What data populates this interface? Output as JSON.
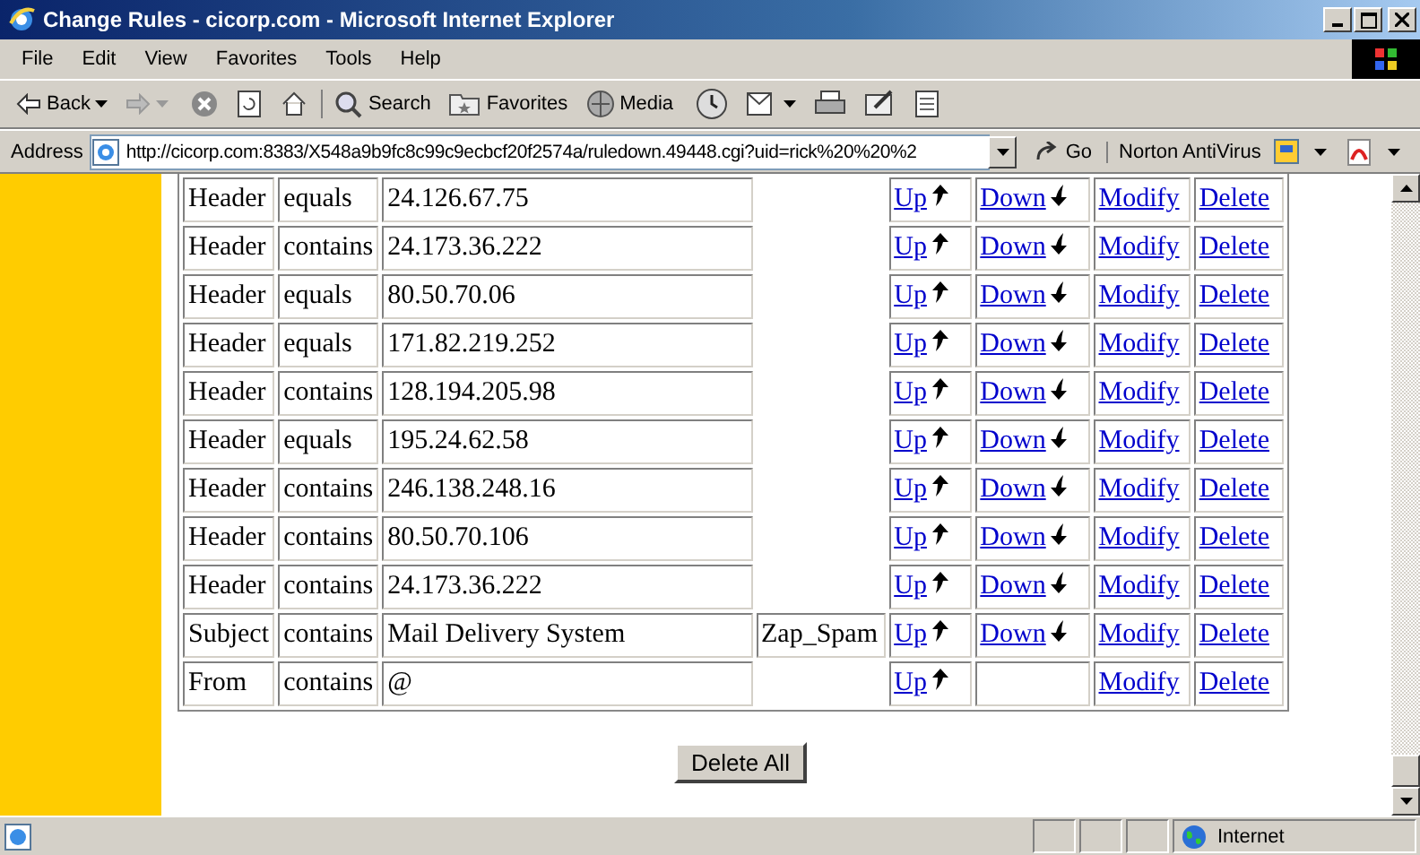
{
  "window": {
    "title": "Change Rules - cicorp.com - Microsoft Internet Explorer"
  },
  "menu": [
    "File",
    "Edit",
    "View",
    "Favorites",
    "Tools",
    "Help"
  ],
  "toolbar": [
    {
      "kind": "back",
      "label": "Back"
    },
    {
      "kind": "forward"
    },
    {
      "kind": "stop"
    },
    {
      "kind": "refresh"
    },
    {
      "kind": "home"
    },
    {
      "kind": "search",
      "label": "Search"
    },
    {
      "kind": "favorites",
      "label": "Favorites"
    },
    {
      "kind": "media",
      "label": "Media"
    },
    {
      "kind": "history"
    },
    {
      "kind": "mail"
    },
    {
      "kind": "print"
    },
    {
      "kind": "edit"
    },
    {
      "kind": "discuss"
    }
  ],
  "address": {
    "label": "Address",
    "url": "http://cicorp.com:8383/X548a9b9fc8c99c9ecbcf20f2574a/ruledown.49448.cgi?uid=rick%20%20%2",
    "go": "Go",
    "norton": "Norton AntiVirus"
  },
  "rules": [
    {
      "field": "Header",
      "operator": "equals",
      "value": "24.126.67.75",
      "up": "Up",
      "down": "Down",
      "modify": "Modify",
      "delete": "Delete"
    },
    {
      "field": "Header",
      "operator": "contains",
      "value": "24.173.36.222",
      "up": "Up",
      "down": "Down",
      "modify": "Modify",
      "delete": "Delete"
    },
    {
      "field": "Header",
      "operator": "equals",
      "value": "80.50.70.06",
      "up": "Up",
      "down": "Down",
      "modify": "Modify",
      "delete": "Delete"
    },
    {
      "field": "Header",
      "operator": "equals",
      "value": "171.82.219.252",
      "up": "Up",
      "down": "Down",
      "modify": "Modify",
      "delete": "Delete"
    },
    {
      "field": "Header",
      "operator": "contains",
      "value": "128.194.205.98",
      "up": "Up",
      "down": "Down",
      "modify": "Modify",
      "delete": "Delete"
    },
    {
      "field": "Header",
      "operator": "equals",
      "value": "195.24.62.58",
      "up": "Up",
      "down": "Down",
      "modify": "Modify",
      "delete": "Delete"
    },
    {
      "field": "Header",
      "operator": "contains",
      "value": "246.138.248.16",
      "up": "Up",
      "down": "Down",
      "modify": "Modify",
      "delete": "Delete"
    },
    {
      "field": "Header",
      "operator": "contains",
      "value": "80.50.70.106",
      "up": "Up",
      "down": "Down",
      "modify": "Modify",
      "delete": "Delete"
    },
    {
      "field": "Header",
      "operator": "contains",
      "value": "24.173.36.222",
      "up": "Up",
      "down": "Down",
      "modify": "Modify",
      "delete": "Delete"
    },
    {
      "field": "Subject",
      "operator": "contains",
      "value": "Mail Delivery System",
      "action": "Zap_Spam",
      "up": "Up",
      "down": "Down",
      "modify": "Modify",
      "delete": "Delete"
    },
    {
      "field": "From",
      "operator": "contains",
      "value": "@",
      "up": "Up",
      "modify": "Modify",
      "delete": "Delete"
    }
  ],
  "delete_all": "Delete All",
  "status_bar": {
    "zone": "Internet"
  }
}
